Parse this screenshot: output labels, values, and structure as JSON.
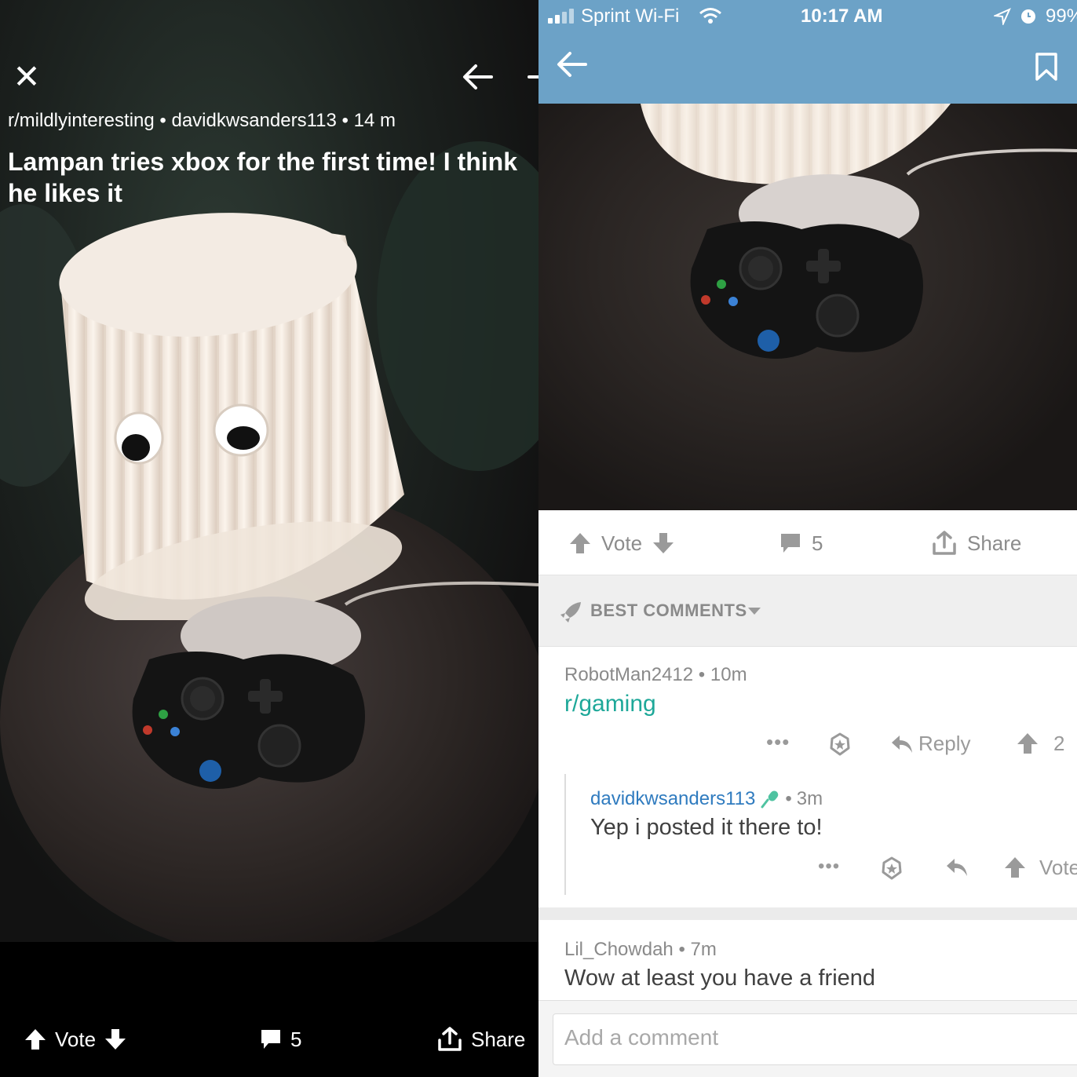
{
  "left": {
    "close_icon": "close-icon",
    "subreddit": "r/mildlyinteresting",
    "separator": "•",
    "author": "davidkwsanders113",
    "age": "14 m",
    "title": "Lampan tries xbox for the first time! I think he likes it",
    "actions": {
      "vote": "Vote",
      "comments": "5",
      "share": "Share"
    }
  },
  "right": {
    "status": {
      "carrier": "Sprint Wi-Fi",
      "time": "10:17 AM",
      "battery": "99%"
    },
    "actions": {
      "vote": "Vote",
      "comments": "5",
      "share": "Share"
    },
    "sort_label": "BEST COMMENTS",
    "comments": [
      {
        "author": "RobotMan2412",
        "age": "10m",
        "body": "r/gaming",
        "reply": "Reply",
        "score": "2"
      },
      {
        "author": "davidkwsanders113",
        "age": "3m",
        "body": "Yep i posted it there to!",
        "vote": "Vote"
      },
      {
        "author": "Lil_Chowdah",
        "age": "7m",
        "body": "Wow at least you have a friend"
      }
    ],
    "add_comment_placeholder": "Add a comment"
  },
  "colors": {
    "header_blue": "#6ca2c7",
    "link_teal": "#1ea899",
    "author_blue": "#2f7bbf",
    "mic_green": "#4fc3a1"
  }
}
